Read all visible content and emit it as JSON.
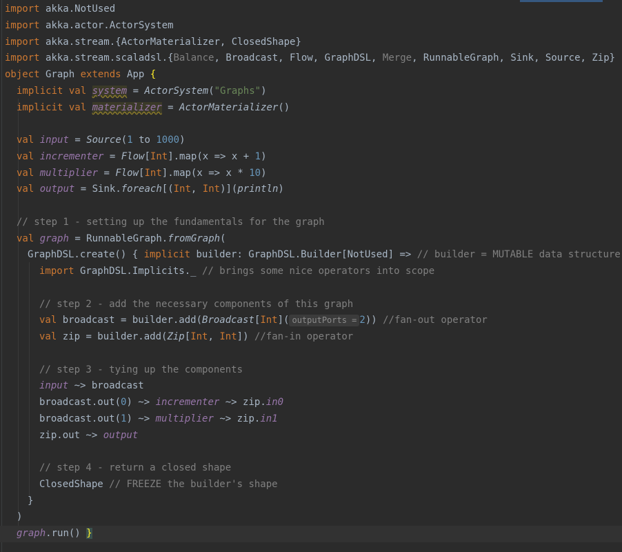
{
  "editor": {
    "lines": [
      {
        "segments": [
          [
            "k",
            "import"
          ],
          [
            "",
            "akka.NotUsed"
          ]
        ]
      },
      {
        "segments": [
          [
            "k",
            "import"
          ],
          [
            "",
            "akka.actor.ActorSystem"
          ]
        ]
      },
      {
        "segments": [
          [
            "k",
            "import"
          ],
          [
            "",
            "akka.stream.{ActorMaterializer, ClosedShape}"
          ]
        ]
      },
      {
        "segments": [
          [
            "k",
            "import"
          ],
          [
            "",
            "akka.stream.scaladsl.{"
          ],
          [
            "g",
            "Balance"
          ],
          [
            "",
            ", Broadcast, Flow, GraphDSL, "
          ],
          [
            "g",
            "Merge"
          ],
          [
            "",
            ", RunnableGraph, Sink, Source, Zip}"
          ]
        ]
      }
    ],
    "code": {
      "l1_kw": "import",
      "l1_rest": " akka.NotUsed",
      "l2_kw": "import",
      "l2_rest": " akka.actor.ActorSystem",
      "l3_kw": "import",
      "l3_rest": " akka.stream.{ActorMaterializer, ClosedShape}",
      "l4_kw": "import",
      "l4_a": " akka.stream.scaladsl.{",
      "l4_g1": "Balance",
      "l4_b": ", Broadcast, Flow, GraphDSL, ",
      "l4_g2": "Merge",
      "l4_c": ", RunnableGraph, Sink, Source, Zip}",
      "l5_kw1": "object",
      "l5_name": " Graph ",
      "l5_kw2": "extends",
      "l5_rest": " App ",
      "l5_brace": "{",
      "l6_kw": "implicit val",
      "l6_var": "system",
      "l6_eq": " = ",
      "l6_cls": "ActorSystem",
      "l6_p": "(",
      "l6_str": "\"Graphs\"",
      "l6_e": ")",
      "l7_kw": "implicit val",
      "l7_var": "materializer",
      "l7_eq": " = ",
      "l7_cls": "ActorMaterializer",
      "l7_e": "()",
      "l9_kw": "val",
      "l9_var": "input",
      "l9_a": " = ",
      "l9_cls": "Source",
      "l9_b": "(",
      "l9_n1": "1",
      "l9_c": " to ",
      "l9_n2": "1000",
      "l9_d": ")",
      "l10_kw": "val",
      "l10_var": "incrementer",
      "l10_a": " = ",
      "l10_cls": "Flow",
      "l10_b": "[",
      "l10_t": "Int",
      "l10_c": "].map(x => x + ",
      "l10_n": "1",
      "l10_d": ")",
      "l11_kw": "val",
      "l11_var": "multiplier",
      "l11_a": " = ",
      "l11_cls": "Flow",
      "l11_b": "[",
      "l11_t": "Int",
      "l11_c": "].map(x => x * ",
      "l11_n": "10",
      "l11_d": ")",
      "l12_kw": "val",
      "l12_var": "output",
      "l12_a": " = Sink.",
      "l12_m": "foreach",
      "l12_b": "[(",
      "l12_t1": "Int",
      "l12_c": ", ",
      "l12_t2": "Int",
      "l12_d": ")](",
      "l12_m2": "println",
      "l12_e": ")",
      "l14_comment": "// step 1 - setting up the fundamentals for the graph",
      "l15_kw": "val",
      "l15_var": "graph",
      "l15_a": " = RunnableGraph.",
      "l15_m": "fromGraph",
      "l15_b": "(",
      "l16_a": "GraphDSL.create() { ",
      "l16_kw": "implicit",
      "l16_b": " builder: GraphDSL.Builder[NotUsed] => ",
      "l16_comment": "// builder = MUTABLE data structure",
      "l17_kw": "import",
      "l17_a": " GraphDSL.Implicits._ ",
      "l17_comment": "// brings some nice operators into scope",
      "l19_comment": "// step 2 - add the necessary components of this graph",
      "l20_kw": "val",
      "l20_a": " broadcast = builder.add(",
      "l20_cls": "Broadcast",
      "l20_b": "[",
      "l20_t": "Int",
      "l20_c": "](",
      "l20_hint": "outputPorts =",
      "l20_n": "2",
      "l20_d": ")) ",
      "l20_comment": "//fan-out operator",
      "l21_kw": "val",
      "l21_a": " zip = builder.add(",
      "l21_cls": "Zip",
      "l21_b": "[",
      "l21_t1": "Int",
      "l21_c": ", ",
      "l21_t2": "Int",
      "l21_d": "]) ",
      "l21_comment": "//fan-in operator",
      "l23_comment": "// step 3 - tying up the components",
      "l24_var": "input",
      "l24_rest": " ~> broadcast",
      "l25_a": "broadcast.out(",
      "l25_n": "0",
      "l25_b": ") ~> ",
      "l25_var": "incrementer",
      "l25_c": " ~> zip.",
      "l25_p": "in0",
      "l26_a": "broadcast.out(",
      "l26_n": "1",
      "l26_b": ") ~> ",
      "l26_var": "multiplier",
      "l26_c": " ~> zip.",
      "l26_p": "in1",
      "l27_a": "zip.out ~> ",
      "l27_var": "output",
      "l29_comment": "// step 4 - return a closed shape",
      "l30_a": "ClosedShape ",
      "l30_comment": "// FREEZE the builder's shape",
      "l31": "}",
      "l32": ")",
      "l33_var": "graph",
      "l33_a": ".run() ",
      "l33_brace": "}"
    }
  }
}
